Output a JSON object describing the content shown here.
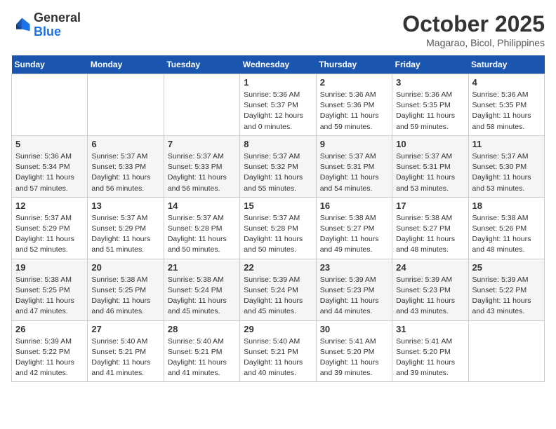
{
  "header": {
    "logo_line1": "General",
    "logo_line2": "Blue",
    "month": "October 2025",
    "location": "Magarao, Bicol, Philippines"
  },
  "weekdays": [
    "Sunday",
    "Monday",
    "Tuesday",
    "Wednesday",
    "Thursday",
    "Friday",
    "Saturday"
  ],
  "weeks": [
    [
      {
        "day": "",
        "info": ""
      },
      {
        "day": "",
        "info": ""
      },
      {
        "day": "",
        "info": ""
      },
      {
        "day": "1",
        "info": "Sunrise: 5:36 AM\nSunset: 5:37 PM\nDaylight: 12 hours\nand 0 minutes."
      },
      {
        "day": "2",
        "info": "Sunrise: 5:36 AM\nSunset: 5:36 PM\nDaylight: 11 hours\nand 59 minutes."
      },
      {
        "day": "3",
        "info": "Sunrise: 5:36 AM\nSunset: 5:35 PM\nDaylight: 11 hours\nand 59 minutes."
      },
      {
        "day": "4",
        "info": "Sunrise: 5:36 AM\nSunset: 5:35 PM\nDaylight: 11 hours\nand 58 minutes."
      }
    ],
    [
      {
        "day": "5",
        "info": "Sunrise: 5:36 AM\nSunset: 5:34 PM\nDaylight: 11 hours\nand 57 minutes."
      },
      {
        "day": "6",
        "info": "Sunrise: 5:37 AM\nSunset: 5:33 PM\nDaylight: 11 hours\nand 56 minutes."
      },
      {
        "day": "7",
        "info": "Sunrise: 5:37 AM\nSunset: 5:33 PM\nDaylight: 11 hours\nand 56 minutes."
      },
      {
        "day": "8",
        "info": "Sunrise: 5:37 AM\nSunset: 5:32 PM\nDaylight: 11 hours\nand 55 minutes."
      },
      {
        "day": "9",
        "info": "Sunrise: 5:37 AM\nSunset: 5:31 PM\nDaylight: 11 hours\nand 54 minutes."
      },
      {
        "day": "10",
        "info": "Sunrise: 5:37 AM\nSunset: 5:31 PM\nDaylight: 11 hours\nand 53 minutes."
      },
      {
        "day": "11",
        "info": "Sunrise: 5:37 AM\nSunset: 5:30 PM\nDaylight: 11 hours\nand 53 minutes."
      }
    ],
    [
      {
        "day": "12",
        "info": "Sunrise: 5:37 AM\nSunset: 5:29 PM\nDaylight: 11 hours\nand 52 minutes."
      },
      {
        "day": "13",
        "info": "Sunrise: 5:37 AM\nSunset: 5:29 PM\nDaylight: 11 hours\nand 51 minutes."
      },
      {
        "day": "14",
        "info": "Sunrise: 5:37 AM\nSunset: 5:28 PM\nDaylight: 11 hours\nand 50 minutes."
      },
      {
        "day": "15",
        "info": "Sunrise: 5:37 AM\nSunset: 5:28 PM\nDaylight: 11 hours\nand 50 minutes."
      },
      {
        "day": "16",
        "info": "Sunrise: 5:38 AM\nSunset: 5:27 PM\nDaylight: 11 hours\nand 49 minutes."
      },
      {
        "day": "17",
        "info": "Sunrise: 5:38 AM\nSunset: 5:27 PM\nDaylight: 11 hours\nand 48 minutes."
      },
      {
        "day": "18",
        "info": "Sunrise: 5:38 AM\nSunset: 5:26 PM\nDaylight: 11 hours\nand 48 minutes."
      }
    ],
    [
      {
        "day": "19",
        "info": "Sunrise: 5:38 AM\nSunset: 5:25 PM\nDaylight: 11 hours\nand 47 minutes."
      },
      {
        "day": "20",
        "info": "Sunrise: 5:38 AM\nSunset: 5:25 PM\nDaylight: 11 hours\nand 46 minutes."
      },
      {
        "day": "21",
        "info": "Sunrise: 5:38 AM\nSunset: 5:24 PM\nDaylight: 11 hours\nand 45 minutes."
      },
      {
        "day": "22",
        "info": "Sunrise: 5:39 AM\nSunset: 5:24 PM\nDaylight: 11 hours\nand 45 minutes."
      },
      {
        "day": "23",
        "info": "Sunrise: 5:39 AM\nSunset: 5:23 PM\nDaylight: 11 hours\nand 44 minutes."
      },
      {
        "day": "24",
        "info": "Sunrise: 5:39 AM\nSunset: 5:23 PM\nDaylight: 11 hours\nand 43 minutes."
      },
      {
        "day": "25",
        "info": "Sunrise: 5:39 AM\nSunset: 5:22 PM\nDaylight: 11 hours\nand 43 minutes."
      }
    ],
    [
      {
        "day": "26",
        "info": "Sunrise: 5:39 AM\nSunset: 5:22 PM\nDaylight: 11 hours\nand 42 minutes."
      },
      {
        "day": "27",
        "info": "Sunrise: 5:40 AM\nSunset: 5:21 PM\nDaylight: 11 hours\nand 41 minutes."
      },
      {
        "day": "28",
        "info": "Sunrise: 5:40 AM\nSunset: 5:21 PM\nDaylight: 11 hours\nand 41 minutes."
      },
      {
        "day": "29",
        "info": "Sunrise: 5:40 AM\nSunset: 5:21 PM\nDaylight: 11 hours\nand 40 minutes."
      },
      {
        "day": "30",
        "info": "Sunrise: 5:41 AM\nSunset: 5:20 PM\nDaylight: 11 hours\nand 39 minutes."
      },
      {
        "day": "31",
        "info": "Sunrise: 5:41 AM\nSunset: 5:20 PM\nDaylight: 11 hours\nand 39 minutes."
      },
      {
        "day": "",
        "info": ""
      }
    ]
  ]
}
